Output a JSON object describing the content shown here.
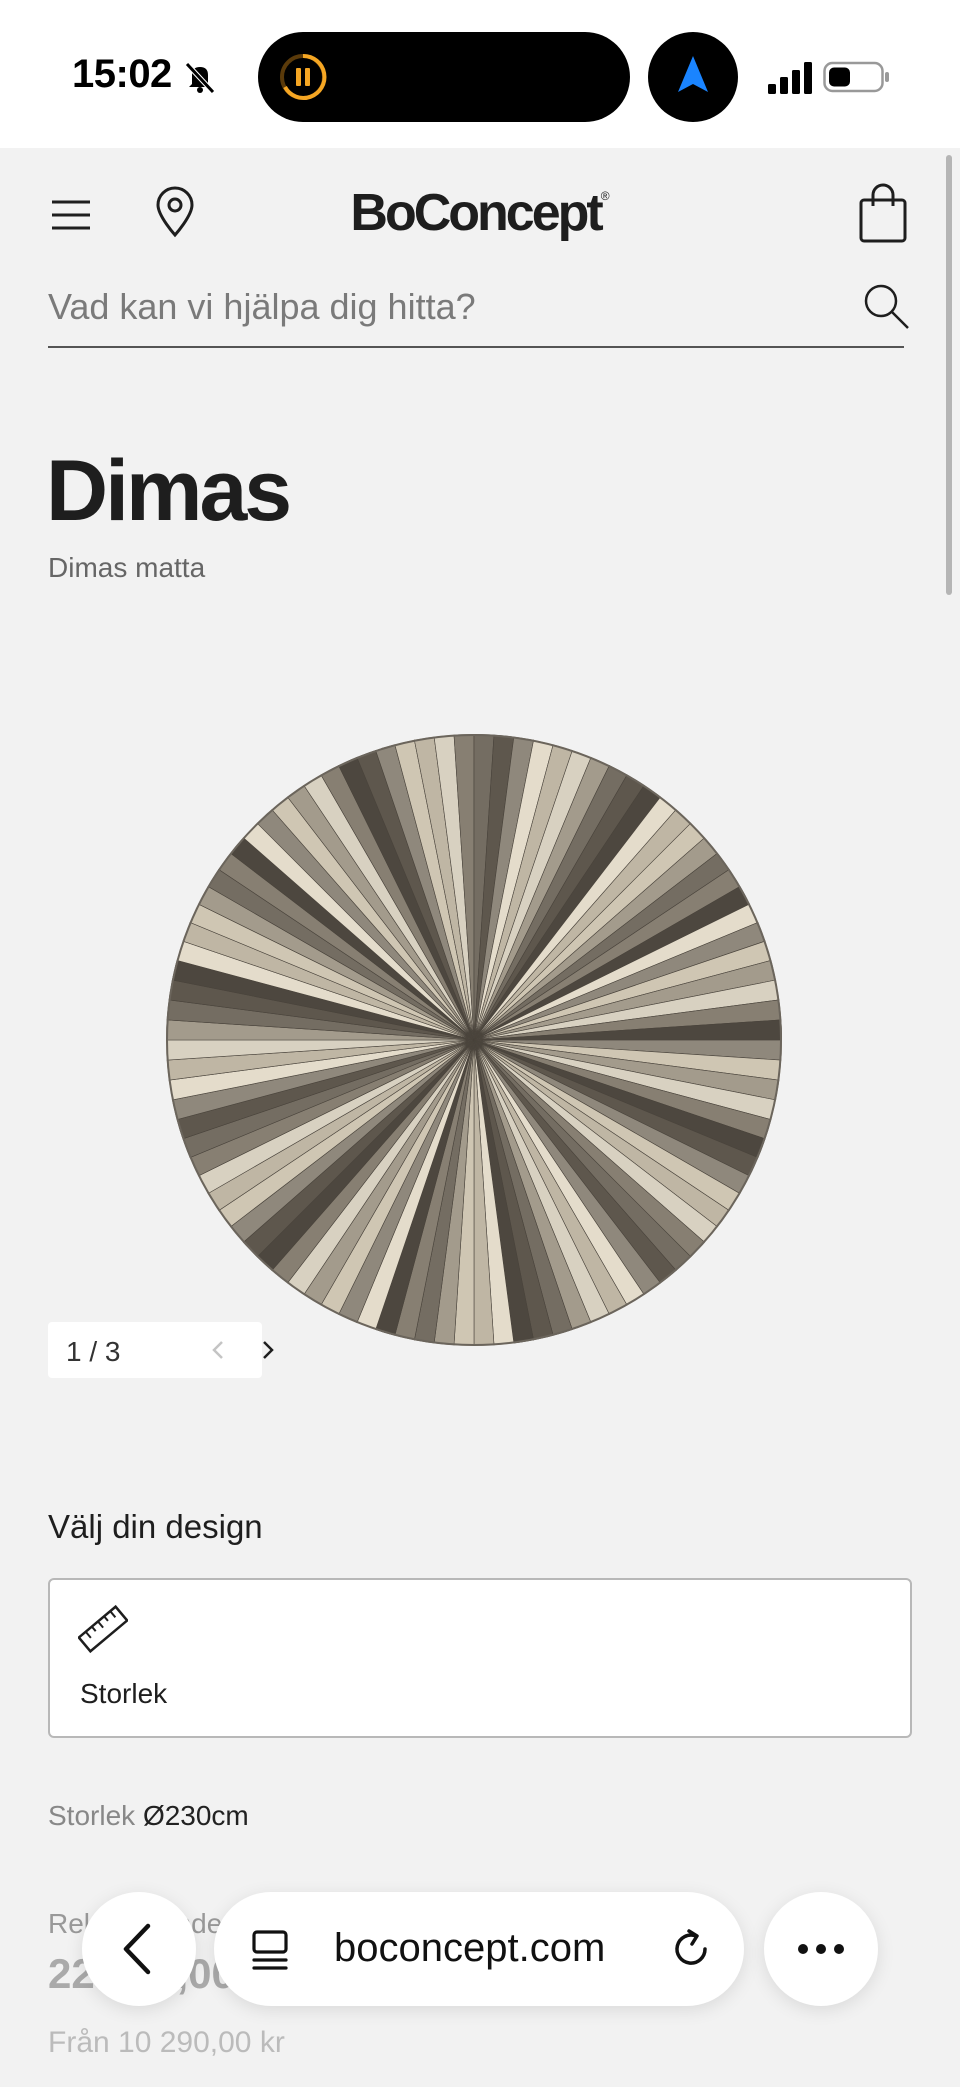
{
  "status_bar": {
    "time": "15:02",
    "battery_level": 0.35
  },
  "header": {
    "brand": "BoConcept",
    "brand_mark": "®"
  },
  "search": {
    "placeholder": "Vad kan vi hjälpa dig hitta?"
  },
  "product": {
    "title": "Dimas",
    "subtitle": "Dimas matta"
  },
  "gallery": {
    "current": 1,
    "total": 3,
    "counter_text": "1 / 3"
  },
  "design": {
    "heading": "Välj din design",
    "size_option_label": "Storlek"
  },
  "size_info": {
    "label": "Storlek",
    "value": "Ø230cm"
  },
  "price": {
    "label": "Rekommenderat pris",
    "value": "22 990,00 kr",
    "from": "Från 10 290,00 kr"
  },
  "browser": {
    "url": "boconcept.com"
  },
  "colors": {
    "background": "#f2f2f2",
    "text": "#1e1e1e",
    "nav_arrow": "#1a84ff"
  }
}
